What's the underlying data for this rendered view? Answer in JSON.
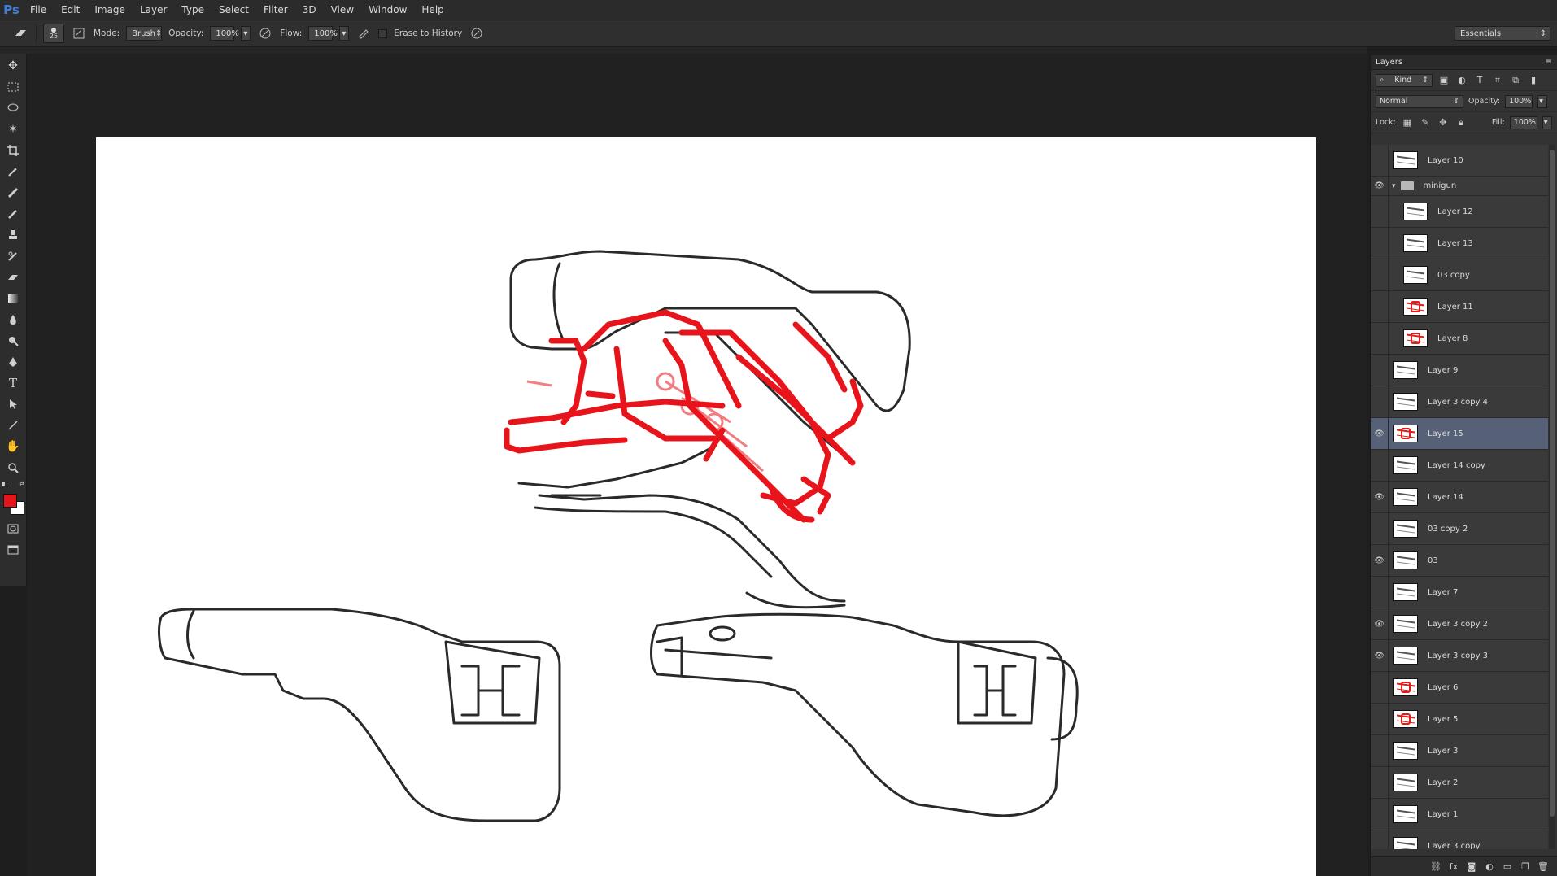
{
  "app": {
    "logo": "Ps"
  },
  "menu": [
    "File",
    "Edit",
    "Image",
    "Layer",
    "Type",
    "Select",
    "Filter",
    "3D",
    "View",
    "Window",
    "Help"
  ],
  "options": {
    "brush_size": "25",
    "mode_label": "Mode:",
    "mode_value": "Brush",
    "opacity_label": "Opacity:",
    "opacity_value": "100%",
    "flow_label": "Flow:",
    "flow_value": "100%",
    "erase_history_label": "Erase to History",
    "workspace": "Essentials"
  },
  "colors": {
    "foreground": "#e8141b",
    "background": "#ffffff",
    "selected_layer": "#566077"
  },
  "layers_panel": {
    "title": "Layers",
    "filter_kind": "Kind",
    "blend_mode": "Normal",
    "opacity_label": "Opacity:",
    "opacity_value": "100%",
    "lock_label": "Lock:",
    "fill_label": "Fill:",
    "fill_value": "100%",
    "layers": [
      {
        "name": "Layer 10",
        "visible": false,
        "type": "layer",
        "indent": false,
        "thumb": "dark"
      },
      {
        "name": "minigun",
        "visible": true,
        "type": "group",
        "indent": false
      },
      {
        "name": "Layer 12",
        "visible": false,
        "type": "layer",
        "indent": true,
        "thumb": "dark"
      },
      {
        "name": "Layer 13",
        "visible": false,
        "type": "layer",
        "indent": true,
        "thumb": "dark"
      },
      {
        "name": "03 copy",
        "visible": false,
        "type": "layer",
        "indent": true,
        "thumb": "dark"
      },
      {
        "name": "Layer 11",
        "visible": false,
        "type": "layer",
        "indent": true,
        "thumb": "red"
      },
      {
        "name": "Layer 8",
        "visible": false,
        "type": "layer",
        "indent": true,
        "thumb": "red"
      },
      {
        "name": "Layer 9",
        "visible": false,
        "type": "layer",
        "indent": false,
        "thumb": "dark"
      },
      {
        "name": "Layer 3 copy 4",
        "visible": false,
        "type": "layer",
        "indent": false,
        "thumb": "dark"
      },
      {
        "name": "Layer 15",
        "visible": true,
        "type": "layer",
        "indent": false,
        "thumb": "red",
        "selected": true
      },
      {
        "name": "Layer 14 copy",
        "visible": false,
        "type": "layer",
        "indent": false,
        "thumb": "dark"
      },
      {
        "name": "Layer 14",
        "visible": true,
        "type": "layer",
        "indent": false,
        "thumb": "dark"
      },
      {
        "name": "03 copy 2",
        "visible": false,
        "type": "layer",
        "indent": false,
        "thumb": "dark"
      },
      {
        "name": "03",
        "visible": true,
        "type": "layer",
        "indent": false,
        "thumb": "dark"
      },
      {
        "name": "Layer 7",
        "visible": false,
        "type": "layer",
        "indent": false,
        "thumb": "dark"
      },
      {
        "name": "Layer 3 copy 2",
        "visible": true,
        "type": "layer",
        "indent": false,
        "thumb": "dark"
      },
      {
        "name": "Layer 3 copy 3",
        "visible": true,
        "type": "layer",
        "indent": false,
        "thumb": "dark"
      },
      {
        "name": "Layer 6",
        "visible": false,
        "type": "layer",
        "indent": false,
        "thumb": "red"
      },
      {
        "name": "Layer 5",
        "visible": false,
        "type": "layer",
        "indent": false,
        "thumb": "red"
      },
      {
        "name": "Layer 3",
        "visible": false,
        "type": "layer",
        "indent": false,
        "thumb": "dark"
      },
      {
        "name": "Layer 2",
        "visible": false,
        "type": "layer",
        "indent": false,
        "thumb": "dark"
      },
      {
        "name": "Layer 1",
        "visible": false,
        "type": "layer",
        "indent": false,
        "thumb": "dark"
      },
      {
        "name": "Layer 3 copy",
        "visible": false,
        "type": "layer",
        "indent": false,
        "thumb": "dark"
      }
    ]
  }
}
